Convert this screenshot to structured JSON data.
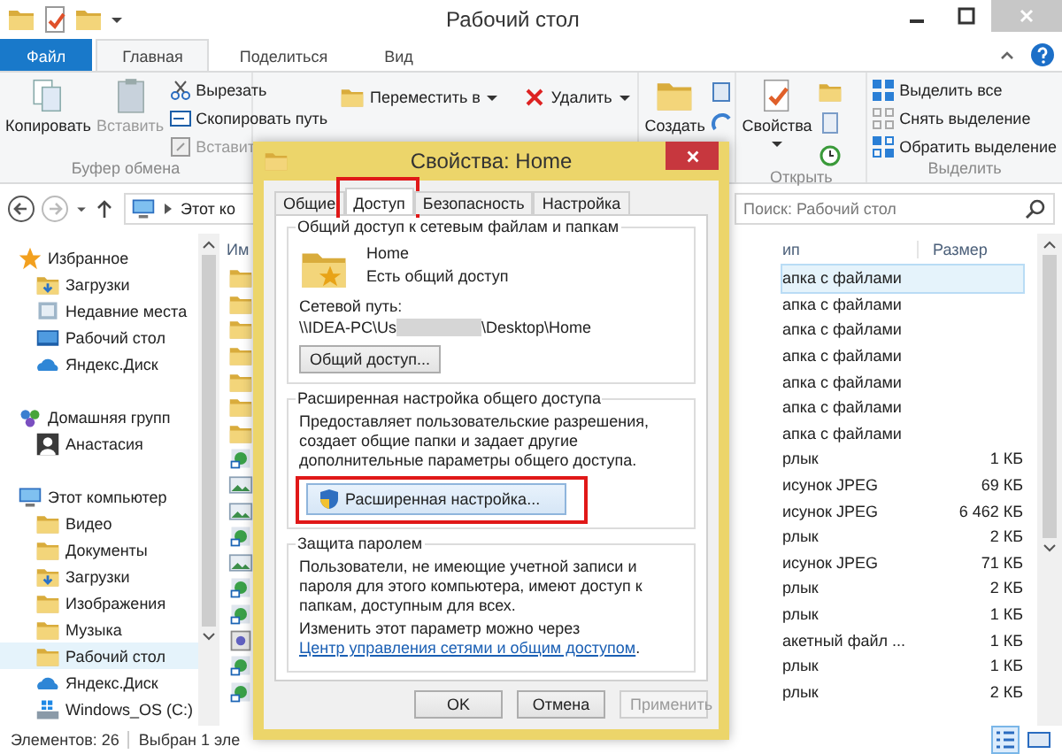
{
  "window": {
    "title": "Рабочий стол"
  },
  "ribbon_tabs": [
    {
      "label": "Файл",
      "kind": "file",
      "selected": false
    },
    {
      "label": "Главная",
      "kind": "tab",
      "selected": true
    },
    {
      "label": "Поделиться",
      "kind": "tab",
      "selected": false
    },
    {
      "label": "Вид",
      "kind": "tab",
      "selected": false
    }
  ],
  "ribbon": {
    "clipboard": {
      "copy": "Копировать",
      "paste": "Вставить",
      "cut": "Вырезать",
      "copy_path": "Скопировать путь",
      "paste_shortcut": "Вставит",
      "label": "Буфер обмена"
    },
    "organize": {
      "move_to": "Переместить в",
      "delete": "Удалить"
    },
    "new": {
      "create": "Создать"
    },
    "open": {
      "properties": "Свойства",
      "label": "Открыть"
    },
    "select": {
      "select_all": "Выделить все",
      "select_none": "Снять выделение",
      "invert": "Обратить выделение",
      "label": "Выделить"
    }
  },
  "address_bar": {
    "path": "Этот ко"
  },
  "search": {
    "placeholder": "Поиск: Рабочий стол"
  },
  "navigation": [
    {
      "label": "Избранное",
      "kind": "star",
      "selected": false,
      "children": [
        {
          "label": "Загрузки",
          "kind": "downloads",
          "selected": false
        },
        {
          "label": "Недавние места",
          "kind": "recent",
          "selected": false
        },
        {
          "label": "Рабочий стол",
          "kind": "desktop",
          "selected": false
        },
        {
          "label": "Яндекс.Диск",
          "kind": "cloud",
          "selected": false
        }
      ]
    },
    {
      "label": "Домашняя групп",
      "kind": "group",
      "selected": false,
      "children": [
        {
          "label": "Анастасия",
          "kind": "user",
          "selected": false
        }
      ]
    },
    {
      "label": "Этот компьютер",
      "kind": "computer",
      "selected": false,
      "children": [
        {
          "label": "Видео",
          "kind": "folder",
          "selected": false
        },
        {
          "label": "Документы",
          "kind": "folder",
          "selected": false
        },
        {
          "label": "Загрузки",
          "kind": "downloads",
          "selected": false
        },
        {
          "label": "Изображения",
          "kind": "folder",
          "selected": false
        },
        {
          "label": "Музыка",
          "kind": "folder",
          "selected": false
        },
        {
          "label": "Рабочий стол",
          "kind": "folder",
          "selected": true
        },
        {
          "label": "Яндекс.Диск",
          "kind": "cloud",
          "selected": false
        },
        {
          "label": "Windows_OS (C:)",
          "kind": "drive",
          "selected": false
        }
      ]
    }
  ],
  "file_list": {
    "columns": [
      "Им",
      "ип",
      "Размер"
    ],
    "rows": [
      {
        "kind": "folder",
        "type": "апка с файлами",
        "selected": true
      },
      {
        "kind": "folder",
        "type": "апка с файлами",
        "selected": false
      },
      {
        "kind": "folder",
        "type": "апка с файлами",
        "selected": false
      },
      {
        "kind": "folder",
        "type": "апка с файлами",
        "selected": false
      },
      {
        "kind": "folder",
        "type": "апка с файлами",
        "selected": false
      },
      {
        "kind": "folder",
        "type": "апка с файлами",
        "selected": false
      },
      {
        "kind": "folder",
        "type": "апка с файлами",
        "selected": false
      },
      {
        "kind": "shortcut",
        "type": "рлык",
        "size": "1 КБ",
        "selected": false
      },
      {
        "kind": "image",
        "type": "исунок JPEG",
        "size": "69 КБ",
        "selected": false
      },
      {
        "kind": "image",
        "type": "исунок JPEG",
        "size": "6 462 КБ",
        "selected": false
      },
      {
        "kind": "shortcut",
        "type": "рлык",
        "size": "2 КБ",
        "selected": false
      },
      {
        "kind": "image",
        "type": "исунок JPEG",
        "size": "71 КБ",
        "selected": false
      },
      {
        "kind": "shortcut",
        "type": "рлык",
        "size": "2 КБ",
        "selected": false
      },
      {
        "kind": "shortcut",
        "type": "рлык",
        "size": "1 КБ",
        "selected": false
      },
      {
        "kind": "batch",
        "type": "акетный файл ...",
        "size": "1 КБ",
        "selected": false
      },
      {
        "kind": "shortcut",
        "type": "рлык",
        "size": "1 КБ",
        "selected": false
      },
      {
        "kind": "shortcut",
        "type": "рлык",
        "size": "2 КБ",
        "selected": false
      }
    ]
  },
  "status_bar": {
    "items_count": "Элементов: 26",
    "selection": "Выбран 1 эле"
  },
  "dialog": {
    "title": "Свойства: Home",
    "tabs": [
      {
        "label": "Общие",
        "selected": false,
        "highlighted": false
      },
      {
        "label": "Доступ",
        "selected": true,
        "highlighted": true
      },
      {
        "label": "Безопасность",
        "selected": false,
        "highlighted": false
      },
      {
        "label": "Настройка",
        "selected": false,
        "highlighted": false
      }
    ],
    "network_sharing": {
      "legend": "Общий доступ к сетевым файлам и папкам",
      "name": "Home",
      "status": "Есть общий доступ",
      "path_label": "Сетевой путь:",
      "path_start": "\\\\IDEA-PC\\Us",
      "path_end": "\\Desktop\\Home",
      "button": "Общий доступ..."
    },
    "advanced_sharing": {
      "legend": "Расширенная настройка общего доступа",
      "description": "Предоставляет пользовательские разрешения, создает общие папки и задает другие дополнительные параметры общего доступа.",
      "button": "Расширенная настройка...",
      "highlighted": true
    },
    "password_protection": {
      "legend": "Защита паролем",
      "description": "Пользователи, не имеющие учетной записи и пароля для этого компьютера, имеют доступ к папкам, доступным для всех.",
      "change_text": "Изменить этот параметр можно через ",
      "link": "Центр управления сетями и общим доступом",
      "after_link": "."
    },
    "buttons": [
      {
        "label": "OK",
        "disabled": false
      },
      {
        "label": "Отмена",
        "disabled": false
      },
      {
        "label": "Применить",
        "disabled": true
      }
    ]
  }
}
